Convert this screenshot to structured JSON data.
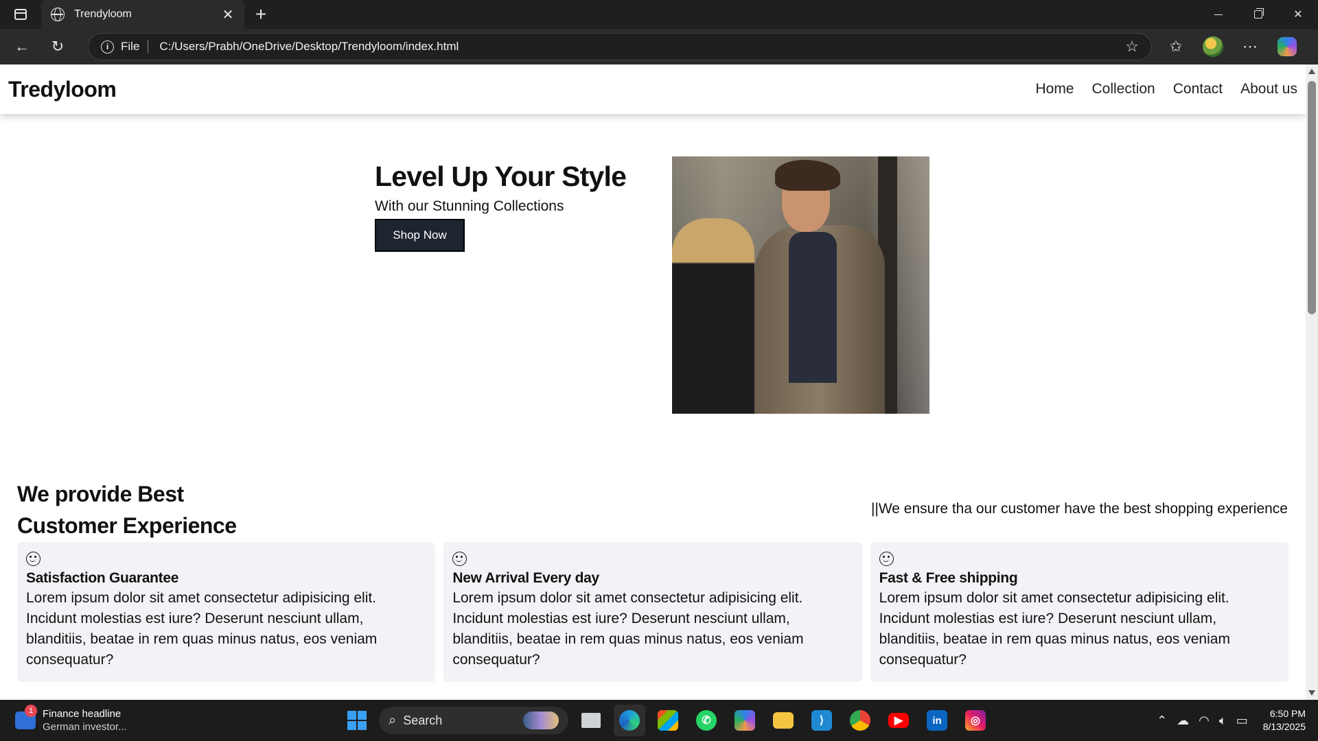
{
  "browser": {
    "tab_title": "Trendyloom",
    "address_prefix": "File",
    "url": "C:/Users/Prabh/OneDrive/Desktop/Trendyloom/index.html"
  },
  "site": {
    "brand": "Tredyloom",
    "nav": [
      "Home",
      "Collection",
      "Contact",
      "About us"
    ],
    "hero": {
      "title": "Level Up Your Style",
      "subtitle": "With our Stunning Collections",
      "cta": "Shop Now"
    },
    "section": {
      "title": "We provide Best Customer Experience",
      "side_text": "||We ensure tha our customer have the best shopping experience"
    },
    "cards": [
      {
        "title": "Satisfaction Guarantee",
        "text": "Lorem ipsum dolor sit amet consectetur adipisicing elit. Incidunt molestias est iure? Deserunt nesciunt ullam, blanditiis, beatae in rem quas minus natus, eos veniam consequatur?"
      },
      {
        "title": "New Arrival Every day",
        "text": "Lorem ipsum dolor sit amet consectetur adipisicing elit. Incidunt molestias est iure? Deserunt nesciunt ullam, blanditiis, beatae in rem quas minus natus, eos veniam consequatur?"
      },
      {
        "title": "Fast & Free shipping",
        "text": "Lorem ipsum dolor sit amet consectetur adipisicing elit. Incidunt molestias est iure? Deserunt nesciunt ullam, blanditiis, beatae in rem quas minus natus, eos veniam consequatur?"
      }
    ]
  },
  "taskbar": {
    "widget_badge": "1",
    "widget_title": "Finance headline",
    "widget_sub": "German investor...",
    "search_label": "Search",
    "time": "6:50 PM",
    "date": "8/13/2025"
  },
  "colors": {
    "cta_bg": "#1e2531",
    "card_bg": "#f2f3f6",
    "start_blue": "#3aa0f3"
  }
}
